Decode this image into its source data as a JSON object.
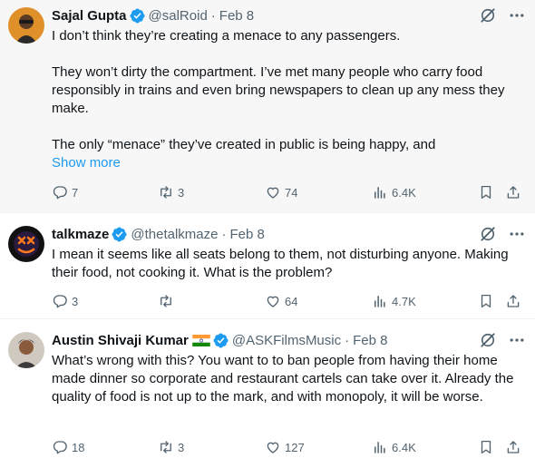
{
  "tweets": [
    {
      "name": "Sajal Gupta",
      "handle": "@salRoid",
      "dot": "·",
      "date": "Feb 8",
      "paragraphs": [
        "I don’t think they’re creating a menace to any passengers.",
        "They won’t dirty the compartment. I’ve met many people who carry food responsibly in trains and even bring newspapers to clean up any mess they make.",
        "The only “menace” they’ve  created in public is being happy, and"
      ],
      "show_more": "Show more",
      "replies": "7",
      "reposts": "3",
      "likes": "74",
      "views": "6.4K"
    },
    {
      "name": "talkmaze",
      "handle": "@thetalkmaze",
      "dot": "·",
      "date": "Feb 8",
      "paragraphs": [
        "I mean it seems like all seats belong to them, not disturbing anyone. Making their food, not cooking it. What is the problem?"
      ],
      "replies": "3",
      "reposts": "",
      "likes": "64",
      "views": "4.7K"
    },
    {
      "name": "Austin Shivaji Kumar",
      "handle": "@ASKFilmsMusic",
      "dot": "·",
      "date": "Feb 8",
      "paragraphs": [
        "What’s wrong with this? You want to to ban people from having their home made dinner so corporate and restaurant cartels can take over it. Already the quality of food is not up to the mark, and with monopoly, it will be worse."
      ],
      "replies": "18",
      "reposts": "3",
      "likes": "127",
      "views": "6.4K"
    }
  ],
  "colors": {
    "verified": "#1d9bf0",
    "muted": "#536471",
    "link": "#1d9bf0",
    "text": "#0f1419"
  },
  "icons": [
    "verified-badge-icon",
    "grok-icon",
    "more-icon",
    "reply-icon",
    "repost-icon",
    "like-icon",
    "views-icon",
    "bookmark-icon",
    "share-icon",
    "india-flag-icon"
  ]
}
